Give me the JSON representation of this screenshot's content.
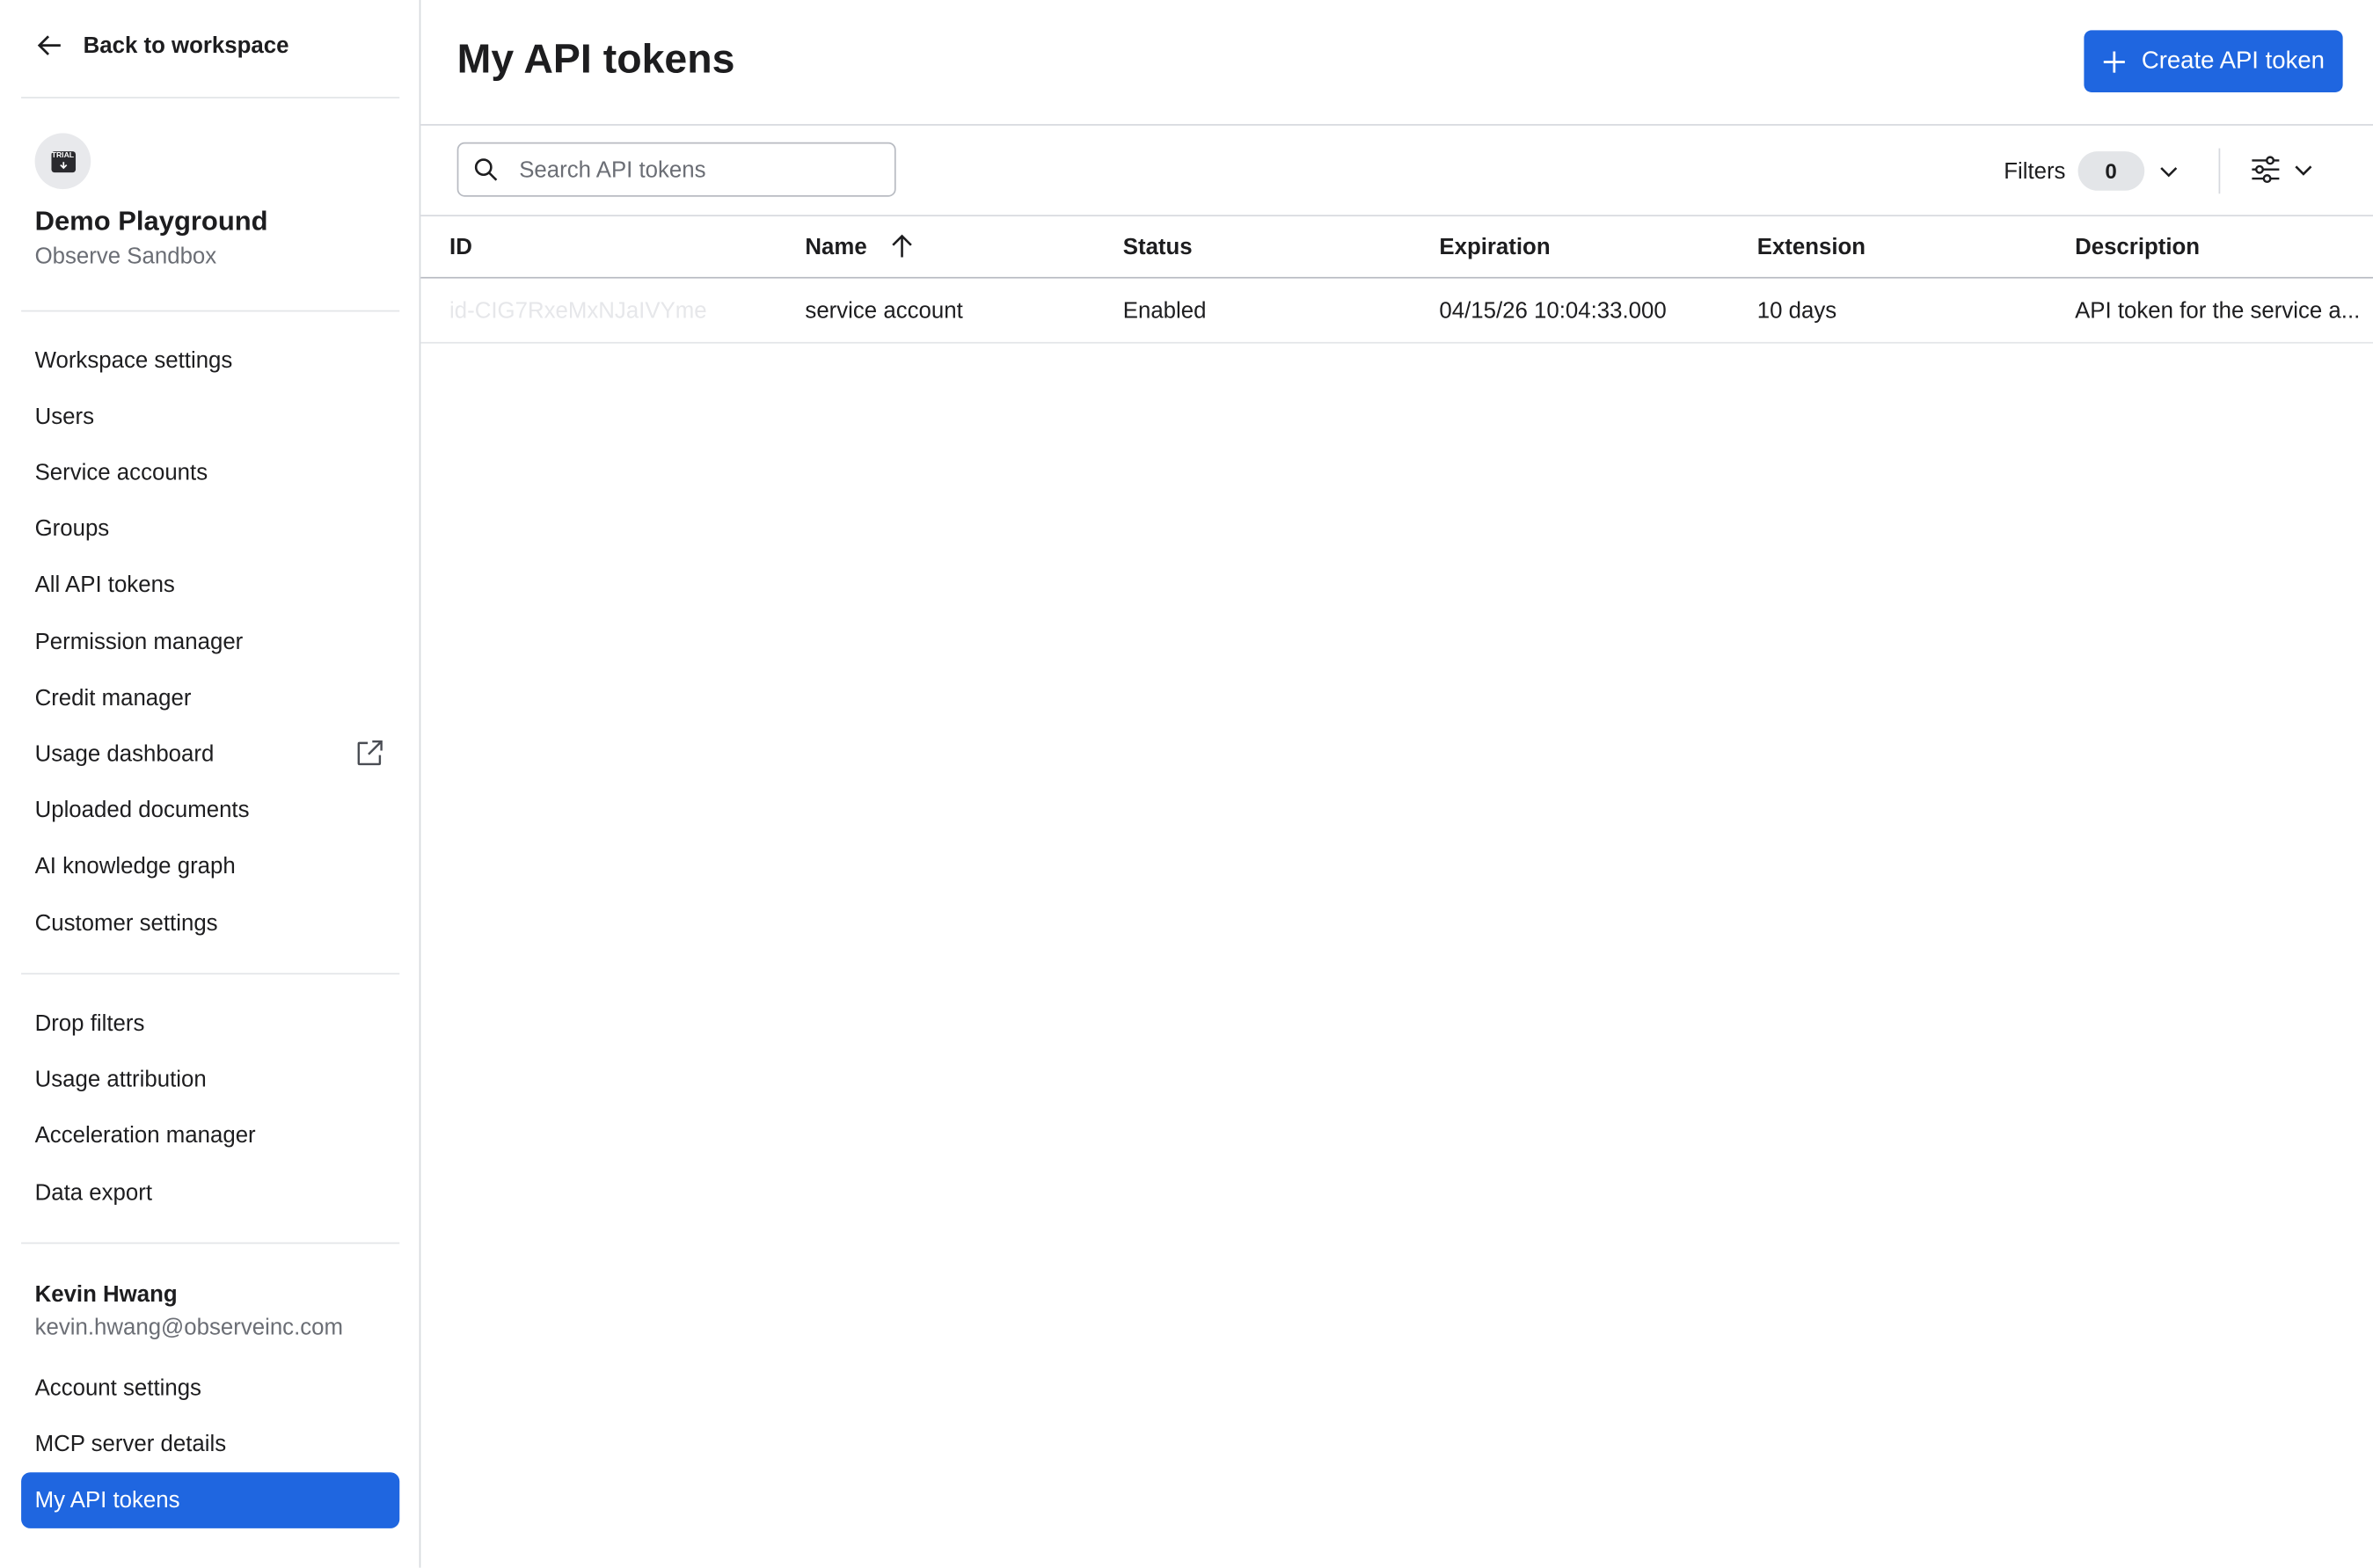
{
  "sidebar": {
    "back_label": "Back to workspace",
    "workspace": {
      "badge": "TRIAL",
      "name": "Demo Playground",
      "subtitle": "Observe Sandbox"
    },
    "nav_group_1": [
      {
        "label": "Workspace settings"
      },
      {
        "label": "Users"
      },
      {
        "label": "Service accounts"
      },
      {
        "label": "Groups"
      },
      {
        "label": "All API tokens"
      },
      {
        "label": "Permission manager"
      },
      {
        "label": "Credit manager"
      },
      {
        "label": "Usage dashboard",
        "icon": "external-link-icon"
      },
      {
        "label": "Uploaded documents"
      },
      {
        "label": "AI knowledge graph"
      },
      {
        "label": "Customer settings"
      }
    ],
    "nav_group_2": [
      {
        "label": "Drop filters"
      },
      {
        "label": "Usage attribution"
      },
      {
        "label": "Acceleration manager"
      },
      {
        "label": "Data export"
      }
    ],
    "user": {
      "name": "Kevin Hwang",
      "email": "kevin.hwang@observeinc.com"
    },
    "nav_group_3": [
      {
        "label": "Account settings"
      },
      {
        "label": "MCP server details"
      },
      {
        "label": "My API tokens",
        "active": true
      }
    ]
  },
  "main": {
    "title": "My API tokens",
    "create_button_label": "Create API token",
    "search_placeholder": "Search API tokens",
    "search_value": "",
    "filters_label": "Filters",
    "filters_count": "0",
    "columns": [
      "ID",
      "Name",
      "Status",
      "Expiration",
      "Extension",
      "Description"
    ],
    "sorted_column": "Name",
    "sort_direction": "ascending",
    "rows": [
      {
        "id": "id-CIG7RxeMxNJaIVYme",
        "name": "service account",
        "status": "Enabled",
        "expiration": "04/15/26 10:04:33.000",
        "extension": "10 days",
        "description": "API token for the service a..."
      }
    ]
  },
  "colors": {
    "accent": "#1f66e0",
    "active_nav_bg": "#1f66e0",
    "border": "#d7d9de",
    "muted_text": "#6b6e75"
  }
}
